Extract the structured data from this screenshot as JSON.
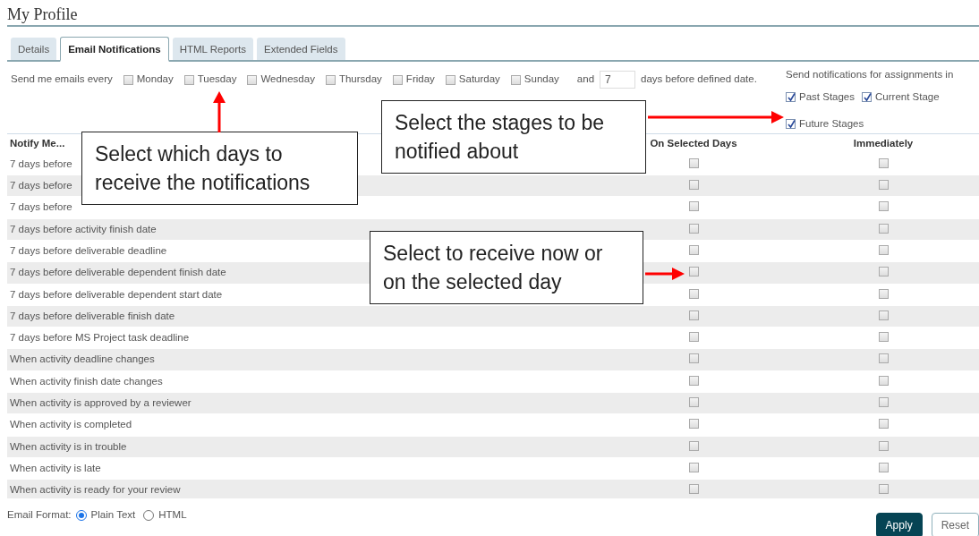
{
  "page_title": "My Profile",
  "tabs": [
    {
      "label": "Details",
      "selected": false
    },
    {
      "label": "Email Notifications",
      "selected": true
    },
    {
      "label": "HTML Reports",
      "selected": false
    },
    {
      "label": "Extended Fields",
      "selected": false
    }
  ],
  "schedule": {
    "label": "Send me emails every",
    "days": [
      {
        "label": "Monday",
        "checked": false
      },
      {
        "label": "Tuesday",
        "checked": false
      },
      {
        "label": "Wednesday",
        "checked": false
      },
      {
        "label": "Thursday",
        "checked": false
      },
      {
        "label": "Friday",
        "checked": false
      },
      {
        "label": "Saturday",
        "checked": false
      },
      {
        "label": "Sunday",
        "checked": false
      }
    ],
    "and_label": "and",
    "days_before": "7",
    "suffix": "days before defined date."
  },
  "stages": {
    "label": "Send notifications for assignments in",
    "options": [
      {
        "label": "Past Stages",
        "checked": true
      },
      {
        "label": "Current Stage",
        "checked": true
      },
      {
        "label": "Future Stages",
        "checked": true
      }
    ]
  },
  "table": {
    "columns": [
      "Notify Me...",
      "On Selected Days",
      "Immediately"
    ],
    "rows": [
      {
        "label": "7 days before",
        "on_selected_days": false,
        "immediately": false
      },
      {
        "label": "7 days before",
        "on_selected_days": false,
        "immediately": false
      },
      {
        "label": "7 days before",
        "on_selected_days": false,
        "immediately": false
      },
      {
        "label": "7 days before activity finish date",
        "on_selected_days": false,
        "immediately": false
      },
      {
        "label": "7 days before deliverable deadline",
        "on_selected_days": false,
        "immediately": false
      },
      {
        "label": "7 days before deliverable dependent finish date",
        "on_selected_days": false,
        "immediately": false
      },
      {
        "label": "7 days before deliverable dependent start date",
        "on_selected_days": false,
        "immediately": false
      },
      {
        "label": "7 days before deliverable finish date",
        "on_selected_days": false,
        "immediately": false
      },
      {
        "label": "7 days before MS Project task deadline",
        "on_selected_days": false,
        "immediately": false
      },
      {
        "label": "When activity deadline changes",
        "on_selected_days": false,
        "immediately": false
      },
      {
        "label": "When activity finish date changes",
        "on_selected_days": false,
        "immediately": false
      },
      {
        "label": "When activity is approved by a reviewer",
        "on_selected_days": false,
        "immediately": false
      },
      {
        "label": "When activity is completed",
        "on_selected_days": false,
        "immediately": false
      },
      {
        "label": "When activity is in trouble",
        "on_selected_days": false,
        "immediately": false
      },
      {
        "label": "When activity is late",
        "on_selected_days": false,
        "immediately": false
      },
      {
        "label": "When activity is ready for your review",
        "on_selected_days": false,
        "immediately": false
      }
    ]
  },
  "email_format": {
    "label": "Email Format:",
    "options": [
      {
        "label": "Plain Text",
        "selected": true
      },
      {
        "label": "HTML",
        "selected": false
      }
    ]
  },
  "buttons": [
    {
      "label": "Apply",
      "kind": "primary"
    },
    {
      "label": "Reset",
      "kind": "secondary"
    }
  ],
  "callouts": [
    {
      "text": "Select which days to receive the notifications"
    },
    {
      "text": "Select the stages to be notified about"
    },
    {
      "text": "Select to receive now or on the selected day"
    }
  ]
}
